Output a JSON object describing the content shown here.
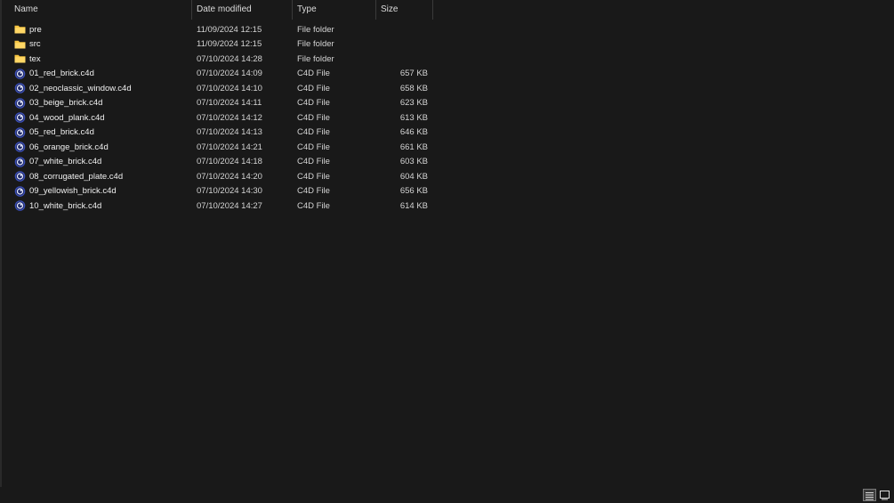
{
  "columns": {
    "name": "Name",
    "date": "Date modified",
    "type": "Type",
    "size": "Size"
  },
  "sort": {
    "column": "name",
    "direction": "ascending",
    "icon": "chevron-up-icon"
  },
  "files": [
    {
      "name": "pre",
      "date": "11/09/2024 12:15",
      "type": "File folder",
      "size": "",
      "icon": "folder-icon"
    },
    {
      "name": "src",
      "date": "11/09/2024 12:15",
      "type": "File folder",
      "size": "",
      "icon": "folder-icon"
    },
    {
      "name": "tex",
      "date": "07/10/2024 14:28",
      "type": "File folder",
      "size": "",
      "icon": "folder-icon"
    },
    {
      "name": "01_red_brick.c4d",
      "date": "07/10/2024 14:09",
      "type": "C4D File",
      "size": "657 KB",
      "icon": "c4d-file-icon"
    },
    {
      "name": "02_neoclassic_window.c4d",
      "date": "07/10/2024 14:10",
      "type": "C4D File",
      "size": "658 KB",
      "icon": "c4d-file-icon"
    },
    {
      "name": "03_beige_brick.c4d",
      "date": "07/10/2024 14:11",
      "type": "C4D File",
      "size": "623 KB",
      "icon": "c4d-file-icon"
    },
    {
      "name": "04_wood_plank.c4d",
      "date": "07/10/2024 14:12",
      "type": "C4D File",
      "size": "613 KB",
      "icon": "c4d-file-icon"
    },
    {
      "name": "05_red_brick.c4d",
      "date": "07/10/2024 14:13",
      "type": "C4D File",
      "size": "646 KB",
      "icon": "c4d-file-icon"
    },
    {
      "name": "06_orange_brick.c4d",
      "date": "07/10/2024 14:21",
      "type": "C4D File",
      "size": "661 KB",
      "icon": "c4d-file-icon"
    },
    {
      "name": "07_white_brick.c4d",
      "date": "07/10/2024 14:18",
      "type": "C4D File",
      "size": "603 KB",
      "icon": "c4d-file-icon"
    },
    {
      "name": "08_corrugated_plate.c4d",
      "date": "07/10/2024 14:20",
      "type": "C4D File",
      "size": "604 KB",
      "icon": "c4d-file-icon"
    },
    {
      "name": "09_yellowish_brick.c4d",
      "date": "07/10/2024 14:30",
      "type": "C4D File",
      "size": "656 KB",
      "icon": "c4d-file-icon"
    },
    {
      "name": "10_white_brick.c4d",
      "date": "07/10/2024 14:27",
      "type": "C4D File",
      "size": "614 KB",
      "icon": "c4d-file-icon"
    }
  ],
  "view": {
    "active": "details",
    "details_icon": "details-view-icon",
    "tiles_icon": "large-icons-view-icon"
  },
  "colors": {
    "background": "#191919",
    "folder": "#f6c441",
    "c4d_ring": "#3b4fb8",
    "text": "#f0f0f0"
  }
}
